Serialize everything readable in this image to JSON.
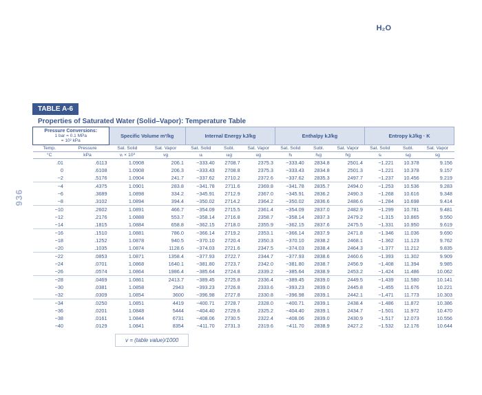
{
  "header": {
    "compound": "H₂O",
    "pageNum": "936"
  },
  "table": {
    "tag": "TABLE A-6",
    "title": "Properties of Saturated Water (Solid–Vapor): Temperature Table",
    "convLabel": "Pressure Conversions:",
    "convLines": [
      "1 bar = 0.1 MPa",
      "= 10² kPa"
    ],
    "footer": "v = (table value)/1000",
    "groupHeads": [
      "Specific Volume m³/kg",
      "Internal Energy kJ/kg",
      "Enthalpy kJ/kg",
      "Entropy kJ/kg · K"
    ],
    "colHead1": [
      "Temp.",
      "Pressure",
      "Sat. Solid",
      "Sat. Vapor",
      "Sat. Solid",
      "Subl.",
      "Sat. Vapor",
      "Sat. Solid",
      "Subl.",
      "Sat. Vapor",
      "Sat. Solid",
      "Subl.",
      "Sat. Vapor"
    ],
    "colHead2": [
      "°C",
      "kPa",
      "vᵢ × 10³",
      "vg",
      "uᵢ",
      "uᵢg",
      "ug",
      "hᵢ",
      "hᵢg",
      "hg",
      "sᵢ",
      "sᵢg",
      "sg"
    ],
    "rows": [
      [
        ".01",
        ".6113",
        "1.0908",
        "206.1",
        "−333.40",
        "2708.7",
        "2375.3",
        "−333.40",
        "2834.8",
        "2501.4",
        "−1.221",
        "10.378",
        "9.156"
      ],
      [
        "0",
        ".6108",
        "1.0908",
        "206.3",
        "−333.43",
        "2708.8",
        "2375.3",
        "−333.43",
        "2834.8",
        "2501.3",
        "−1.221",
        "10.378",
        "9.157"
      ],
      [
        "−2",
        ".5176",
        "1.0904",
        "241.7",
        "−337.62",
        "2710.2",
        "2372.6",
        "−337.62",
        "2835.3",
        "2497.7",
        "−1.237",
        "10.456",
        "9.219"
      ],
      [
        "−4",
        ".4375",
        "1.0901",
        "283.8",
        "−341.78",
        "2711.6",
        "2369.8",
        "−341.78",
        "2835.7",
        "2494.0",
        "−1.253",
        "10.536",
        "9.283"
      ],
      [
        "−6",
        ".3689",
        "1.0898",
        "334.2",
        "−345.91",
        "2712.9",
        "2367.0",
        "−345.91",
        "2836.2",
        "2490.3",
        "−1.268",
        "10.616",
        "9.348"
      ],
      [
        "−8",
        ".3102",
        "1.0894",
        "394.4",
        "−350.02",
        "2714.2",
        "2364.2",
        "−350.02",
        "2836.6",
        "2486.6",
        "−1.284",
        "10.698",
        "9.414"
      ],
      [
        "−10",
        ".2602",
        "1.0891",
        "466.7",
        "−354.09",
        "2715.5",
        "2361.4",
        "−354.09",
        "2837.0",
        "2482.9",
        "−1.299",
        "10.781",
        "9.481"
      ],
      [
        "−12",
        ".2176",
        "1.0888",
        "553.7",
        "−358.14",
        "2716.8",
        "2358.7",
        "−358.14",
        "2837.3",
        "2479.2",
        "−1.315",
        "10.865",
        "9.550"
      ],
      [
        "−14",
        ".1815",
        "1.0884",
        "658.8",
        "−362.15",
        "2718.0",
        "2355.9",
        "−362.15",
        "2837.6",
        "2475.5",
        "−1.331",
        "10.950",
        "9.619"
      ],
      [
        "−16",
        ".1510",
        "1.0881",
        "786.0",
        "−366.14",
        "2719.2",
        "2353.1",
        "−366.14",
        "2837.9",
        "2471.8",
        "−1.346",
        "11.036",
        "9.690"
      ],
      [
        "−18",
        ".1252",
        "1.0878",
        "940.5",
        "−370.10",
        "2720.4",
        "2350.3",
        "−370.10",
        "2838.2",
        "2468.1",
        "−1.362",
        "11.123",
        "9.762"
      ],
      [
        "−20",
        ".1035",
        "1.0874",
        "1128.6",
        "−374.03",
        "2721.6",
        "2347.5",
        "−374.03",
        "2838.4",
        "2464.3",
        "−1.377",
        "11.212",
        "9.835"
      ],
      [
        "−22",
        ".0853",
        "1.0871",
        "1358.4",
        "−377.93",
        "2722.7",
        "2344.7",
        "−377.93",
        "2838.6",
        "2460.6",
        "−1.393",
        "11.302",
        "9.909"
      ],
      [
        "−24",
        ".0701",
        "1.0868",
        "1640.1",
        "−381.80",
        "2723.7",
        "2342.0",
        "−381.80",
        "2838.7",
        "2456.9",
        "−1.408",
        "11.394",
        "9.985"
      ],
      [
        "−26",
        ".0574",
        "1.0864",
        "1986.4",
        "−385.64",
        "2724.8",
        "2339.2",
        "−385.64",
        "2838.9",
        "2453.2",
        "−1.424",
        "11.486",
        "10.062"
      ],
      [
        "−28",
        ".0469",
        "1.0861",
        "2413.7",
        "−389.45",
        "2725.8",
        "2336.4",
        "−389.45",
        "2839.0",
        "2449.5",
        "−1.439",
        "11.580",
        "10.141"
      ],
      [
        "−30",
        ".0381",
        "1.0858",
        "2943",
        "−393.23",
        "2726.8",
        "2333.6",
        "−393.23",
        "2839.0",
        "2445.8",
        "−1.455",
        "11.676",
        "10.221"
      ],
      [
        "−32",
        ".0309",
        "1.0854",
        "3600",
        "−396.98",
        "2727.8",
        "2330.8",
        "−396.98",
        "2839.1",
        "2442.1",
        "−1.471",
        "11.773",
        "10.303"
      ],
      [
        "−34",
        ".0250",
        "1.0851",
        "4419",
        "−400.71",
        "2728.7",
        "2328.0",
        "−400.71",
        "2839.1",
        "2438.4",
        "−1.486",
        "11.872",
        "10.386"
      ],
      [
        "−36",
        ".0201",
        "1.0848",
        "5444",
        "−404.40",
        "2729.6",
        "2325.2",
        "−404.40",
        "2839.1",
        "2434.7",
        "−1.501",
        "11.972",
        "10.470"
      ],
      [
        "−38",
        ".0161",
        "1.0844",
        "6731",
        "−408.06",
        "2730.5",
        "2322.4",
        "−408.06",
        "2839.0",
        "2430.9",
        "−1.517",
        "12.073",
        "10.556"
      ],
      [
        "−40",
        ".0129",
        "1.0841",
        "8354",
        "−411.70",
        "2731.3",
        "2319.6",
        "−411.70",
        "2838.9",
        "2427.2",
        "−1.532",
        "12.176",
        "10.644"
      ]
    ]
  }
}
